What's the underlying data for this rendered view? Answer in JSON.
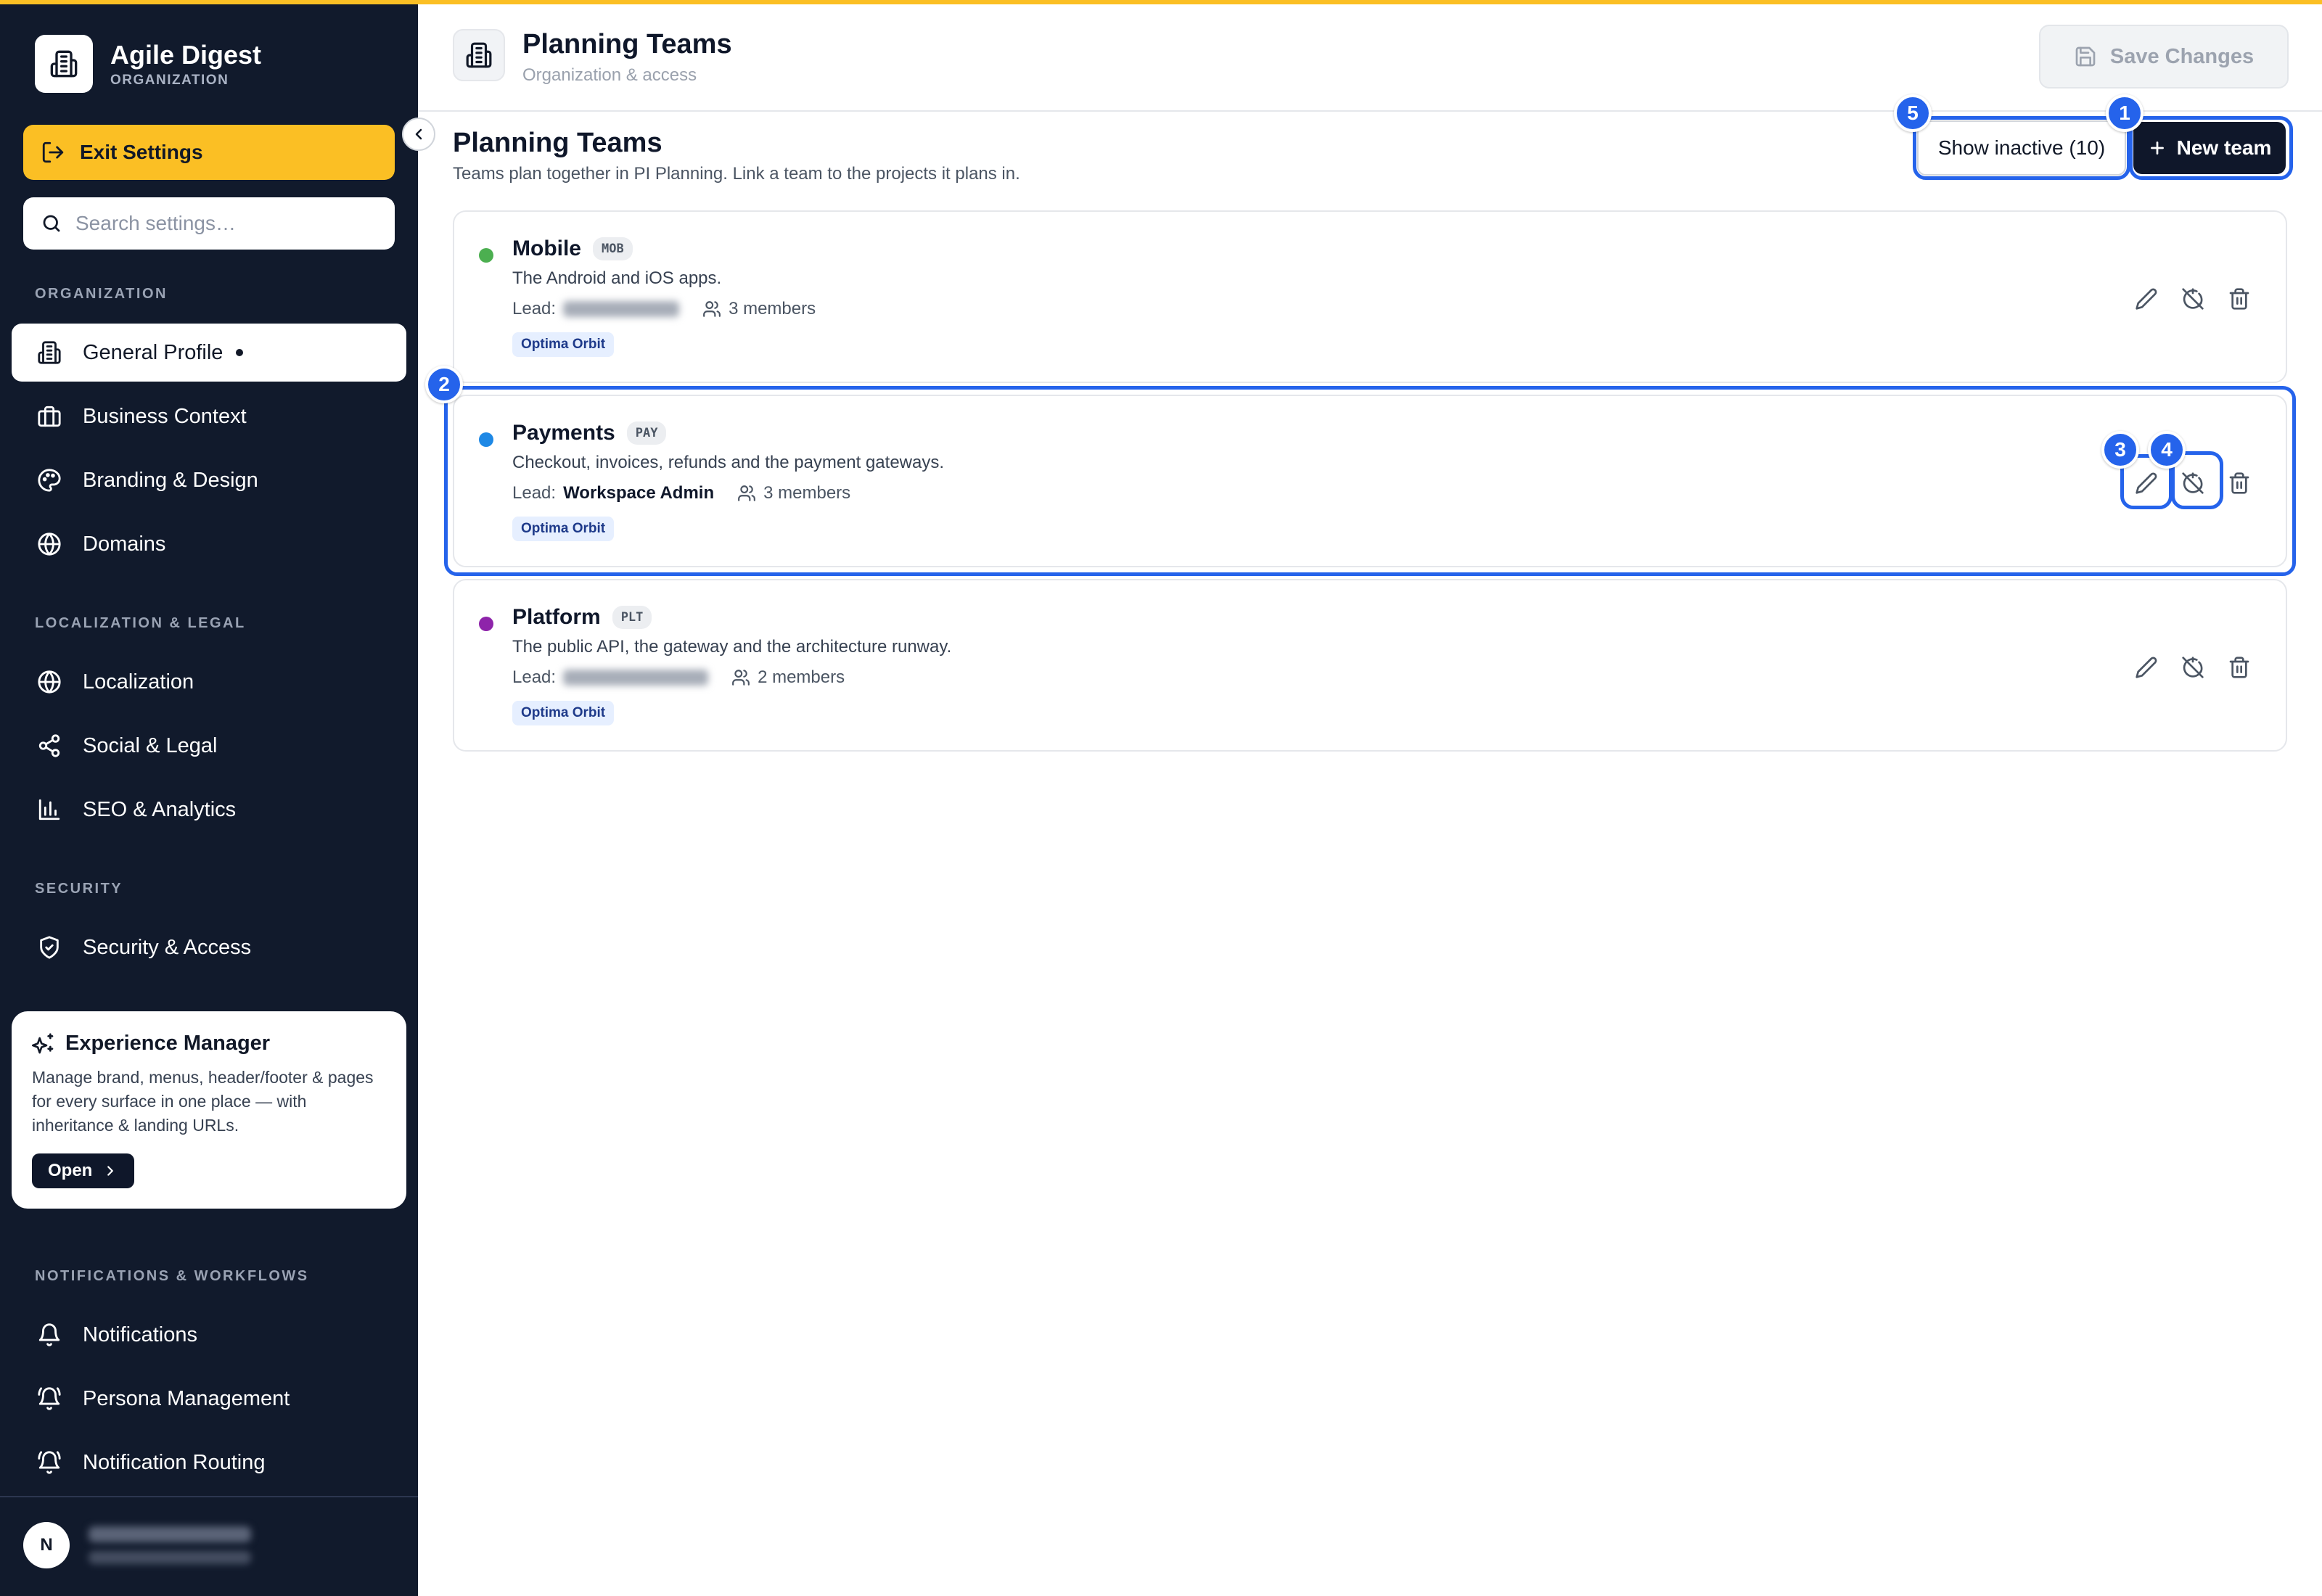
{
  "brand": {
    "name": "Agile Digest",
    "subtitle": "ORGANIZATION"
  },
  "sidebar": {
    "exit_label": "Exit Settings",
    "search_placeholder": "Search settings…",
    "sections": [
      {
        "title": "ORGANIZATION",
        "items": [
          {
            "label": "General Profile",
            "icon": "building-icon",
            "active": true
          },
          {
            "label": "Business Context",
            "icon": "briefcase-icon"
          },
          {
            "label": "Branding & Design",
            "icon": "palette-icon"
          },
          {
            "label": "Domains",
            "icon": "globe-icon"
          }
        ]
      },
      {
        "title": "LOCALIZATION & LEGAL",
        "items": [
          {
            "label": "Localization",
            "icon": "globe-icon"
          },
          {
            "label": "Social & Legal",
            "icon": "share-icon"
          },
          {
            "label": "SEO & Analytics",
            "icon": "bar-chart-icon"
          }
        ]
      },
      {
        "title": "SECURITY",
        "items": [
          {
            "label": "Security & Access",
            "icon": "shield-check-icon"
          }
        ]
      },
      {
        "title": "NOTIFICATIONS & WORKFLOWS",
        "items": [
          {
            "label": "Notifications",
            "icon": "bell-icon"
          },
          {
            "label": "Persona Management",
            "icon": "bell-ring-icon"
          },
          {
            "label": "Notification Routing",
            "icon": "bell-ring-icon"
          }
        ]
      }
    ],
    "experience_card": {
      "title": "Experience Manager",
      "description": "Manage brand, menus, header/footer & pages for every surface in one place — with inheritance & landing URLs.",
      "open_label": "Open"
    },
    "user": {
      "initial": "N"
    }
  },
  "header": {
    "title": "Planning Teams",
    "subtitle": "Organization & access",
    "save_label": "Save Changes"
  },
  "content": {
    "title": "Planning Teams",
    "description": "Teams plan together in PI Planning. Link a team to the projects it plans in.",
    "show_inactive_label": "Show inactive (10)",
    "new_team_label": "New team",
    "lead_prefix": "Lead:",
    "teams": [
      {
        "name": "Mobile",
        "code": "MOB",
        "color": "#4caf50",
        "description": "The Android and iOS apps.",
        "lead": "",
        "members": "3 members",
        "project": "Optima Orbit"
      },
      {
        "name": "Payments",
        "code": "PAY",
        "color": "#1e88e5",
        "description": "Checkout, invoices, refunds and the payment gateways.",
        "lead": "Workspace Admin",
        "members": "3 members",
        "project": "Optima Orbit"
      },
      {
        "name": "Platform",
        "code": "PLT",
        "color": "#8e24aa",
        "description": "The public API, the gateway and the architecture runway.",
        "lead": "",
        "members": "2 members",
        "project": "Optima Orbit"
      }
    ]
  },
  "annotations": {
    "markers": [
      "1",
      "2",
      "3",
      "4",
      "5"
    ],
    "color": "#2563eb"
  },
  "colors": {
    "accent": "#fbbf24",
    "sidebar_bg": "#111a2c",
    "primary_dark": "#0f172a"
  }
}
